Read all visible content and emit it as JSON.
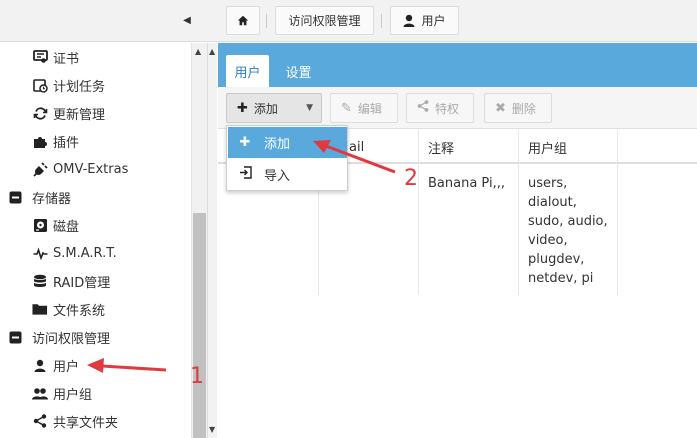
{
  "topbar": {
    "collapse_icon": "chevron-left-icon",
    "breadcrumb": {
      "home_icon": "home-icon",
      "section": "访问权限管理",
      "page": "用户",
      "page_icon": "user-icon"
    }
  },
  "sidebar": {
    "items": [
      {
        "label": "证书",
        "icon": "certificate-icon",
        "level": 2
      },
      {
        "label": "计划任务",
        "icon": "calendar-clock-icon",
        "level": 2
      },
      {
        "label": "更新管理",
        "icon": "refresh-icon",
        "level": 2
      },
      {
        "label": "插件",
        "icon": "puzzle-icon",
        "level": 2
      },
      {
        "label": "OMV-Extras",
        "icon": "plug-icon",
        "level": 2
      },
      {
        "label": "存储器",
        "icon": "minus-square-icon",
        "level": 1
      },
      {
        "label": "磁盘",
        "icon": "disk-icon",
        "level": 2
      },
      {
        "label": "S.M.A.R.T.",
        "icon": "pulse-icon",
        "level": 2
      },
      {
        "label": "RAID管理",
        "icon": "database-icon",
        "level": 2
      },
      {
        "label": "文件系统",
        "icon": "folder-icon",
        "level": 2
      },
      {
        "label": "访问权限管理",
        "icon": "minus-square-icon",
        "level": 1
      },
      {
        "label": "用户",
        "icon": "user-icon",
        "level": 2
      },
      {
        "label": "用户组",
        "icon": "users-icon",
        "level": 2
      },
      {
        "label": "共享文件夹",
        "icon": "share-icon",
        "level": 2
      }
    ]
  },
  "tabs": [
    {
      "label": "用户",
      "active": true
    },
    {
      "label": "设置",
      "active": false
    }
  ],
  "toolbar": {
    "add": "添加",
    "edit": "编辑",
    "privileges": "特权",
    "delete": "删除"
  },
  "dropdown": {
    "items": [
      {
        "label": "添加",
        "icon": "plus-icon"
      },
      {
        "label": "导入",
        "icon": "import-icon"
      }
    ]
  },
  "table": {
    "columns": [
      "ail",
      "注释",
      "用户组"
    ],
    "rows": [
      {
        "comment": "Banana Pi,,,",
        "groups": [
          "users,",
          "dialout,",
          "sudo, audio,",
          "video,",
          "plugdev,",
          "netdev, pi"
        ]
      }
    ]
  },
  "annotations": {
    "marker_1": "1",
    "marker_2": "2"
  },
  "colors": {
    "accent": "#5aa9dc",
    "annotation": "#e03a3e",
    "tab_text": "#2f7fc1"
  }
}
